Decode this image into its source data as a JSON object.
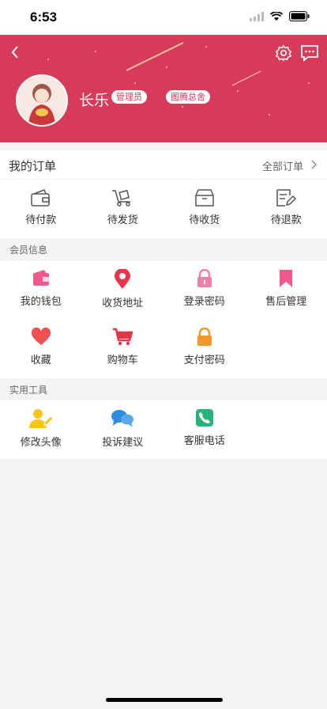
{
  "status_bar": {
    "time": "6:53"
  },
  "profile": {
    "name": "长乐",
    "badges": [
      "管理员",
      "图腾总舍"
    ]
  },
  "orders": {
    "title": "我的订单",
    "all_label": "全部订单",
    "items": [
      {
        "label": "待付款",
        "icon": "wallet-icon"
      },
      {
        "label": "待发货",
        "icon": "cart-dolly-icon"
      },
      {
        "label": "待收货",
        "icon": "box-icon"
      },
      {
        "label": "待退款",
        "icon": "refund-edit-icon"
      }
    ]
  },
  "member": {
    "title": "会员信息",
    "items": [
      {
        "label": "我的钱包",
        "icon": "wallet-icon",
        "color": "#f05a8a"
      },
      {
        "label": "收货地址",
        "icon": "location-pin-icon",
        "color": "#e8334a"
      },
      {
        "label": "登录密码",
        "icon": "lock-icon",
        "color": "#f07fa8"
      },
      {
        "label": "售后管理",
        "icon": "bookmark-icon",
        "color": "#f05a8a"
      },
      {
        "label": "收藏",
        "icon": "heart-icon",
        "color": "#ee4f50"
      },
      {
        "label": "购物车",
        "icon": "shopping-cart-icon",
        "color": "#e8334a"
      },
      {
        "label": "支付密码",
        "icon": "lock-icon",
        "color": "#f1972c"
      }
    ]
  },
  "tools": {
    "title": "实用工具",
    "items": [
      {
        "label": "修改头像",
        "icon": "edit-user-icon",
        "color": "#f5c518"
      },
      {
        "label": "投诉建议",
        "icon": "chat-bubbles-icon",
        "color": "#2d8be0"
      },
      {
        "label": "客服电话",
        "icon": "phone-icon",
        "color": "#2ab27b"
      }
    ]
  },
  "colors": {
    "header": "#d83a59",
    "accent": "#d83a59"
  }
}
